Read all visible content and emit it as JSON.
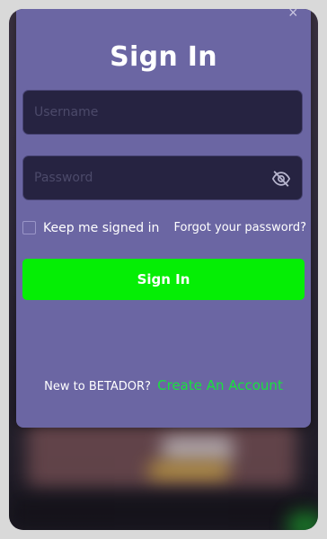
{
  "modal": {
    "close_symbol": "×",
    "title": "Sign In",
    "username_placeholder": "Username",
    "password_placeholder": "Password",
    "password_toggle_icon": "eye-off-icon",
    "remember_label": "Keep me signed in",
    "remember_checked": false,
    "forgot_link": "Forgot your password?",
    "signin_button": "Sign In",
    "footer_prompt": "New to BETADOR?",
    "create_account_link": "Create An Account"
  },
  "colors": {
    "modal_bg": "#6b66a3",
    "input_bg": "#262341",
    "button_bg": "#05ee05",
    "link_green": "#19e23d"
  }
}
